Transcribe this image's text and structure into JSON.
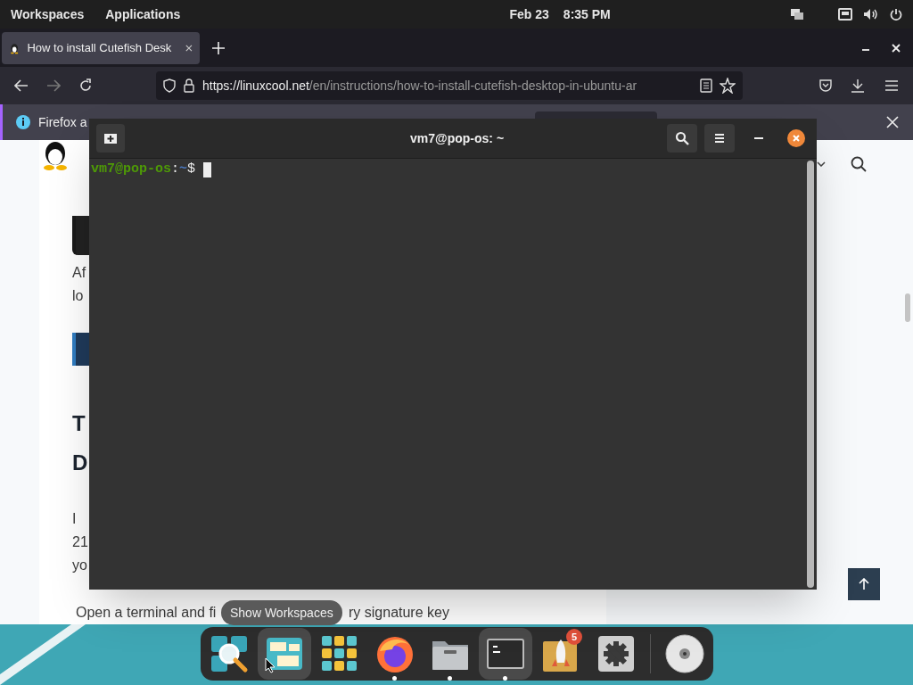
{
  "top_bar": {
    "menus": [
      "Workspaces",
      "Applications"
    ],
    "date": "Feb 23",
    "time": "8:35 PM"
  },
  "browser": {
    "tabs": [
      {
        "title": "How to install Cutefish Desk",
        "selected": true
      }
    ],
    "url": {
      "host": "https://linuxcool.net",
      "path": "/en/instructions/how-to-install-cutefish-desktop-in-ubuntu-ar"
    },
    "notification": "Firefox a",
    "page": {
      "blocks": [
        {
          "kind": "image"
        },
        {
          "kind": "text",
          "text": "Af"
        },
        {
          "kind": "text",
          "text": "lo"
        },
        {
          "kind": "banner"
        },
        {
          "kind": "heading",
          "text": "T"
        },
        {
          "kind": "heading",
          "text": "D"
        },
        {
          "kind": "text",
          "text": "I"
        },
        {
          "kind": "text",
          "text": "21"
        },
        {
          "kind": "text",
          "text": "yo"
        }
      ],
      "last_line": [
        "Open a terminal and fi",
        "ry signature key"
      ]
    }
  },
  "terminal": {
    "title": "vm7@pop-os: ~",
    "prompt": {
      "user_host": "vm7@pop-os",
      "separator": ":",
      "path": "~",
      "symbol": "$"
    }
  },
  "tooltip": "Show Workspaces",
  "dock": {
    "items": [
      {
        "kind": "search",
        "running": false,
        "highlighted": false
      },
      {
        "kind": "workspaces",
        "running": false,
        "highlighted": true
      },
      {
        "kind": "apps",
        "running": false,
        "highlighted": false
      },
      {
        "kind": "firefox",
        "running": true,
        "highlighted": false
      },
      {
        "kind": "files",
        "running": true,
        "highlighted": false
      },
      {
        "kind": "terminal",
        "running": true,
        "highlighted": true
      },
      {
        "kind": "launcher",
        "running": false,
        "highlighted": false,
        "badge": "5"
      },
      {
        "kind": "settings",
        "running": false,
        "highlighted": false
      },
      {
        "kind": "divider"
      },
      {
        "kind": "disc",
        "running": false,
        "highlighted": false
      }
    ]
  }
}
